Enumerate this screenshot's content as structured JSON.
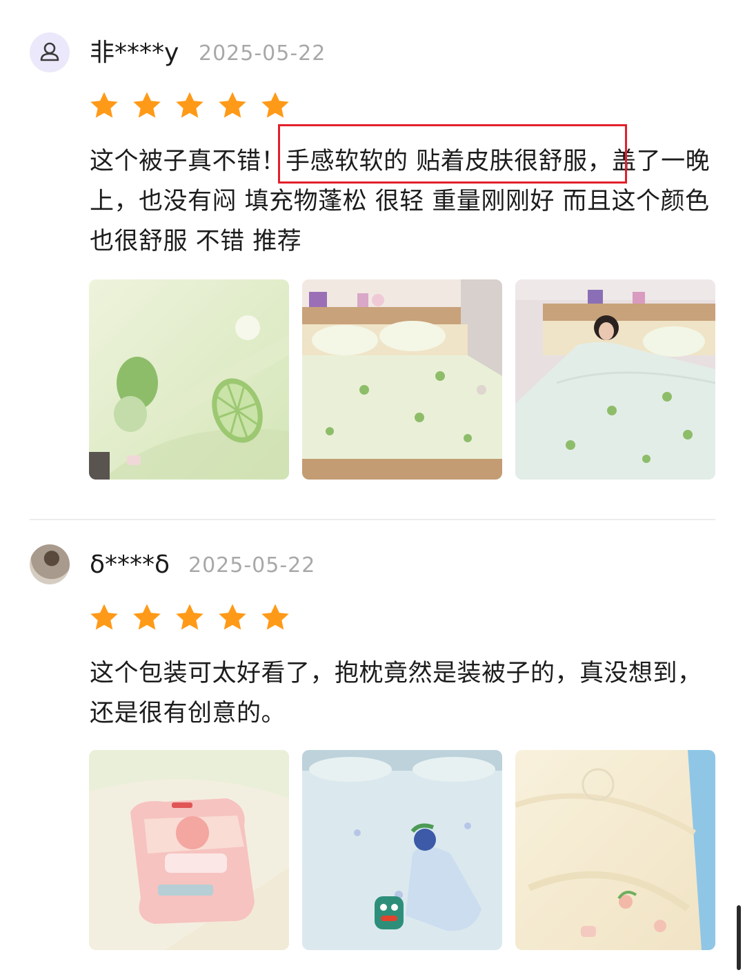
{
  "reviews": [
    {
      "username": "非****y",
      "date": "2025-05-22",
      "rating": 5,
      "text": "这个被子真不错！手感软软的 贴着皮肤很舒服，盖了一晚上，也没有闷 填充物蓬松 很轻 重量刚刚好 而且这个颜色也很舒服 不错 推荐",
      "avatar_icon": "person-icon",
      "photos": 3
    },
    {
      "username": "δ****δ",
      "date": "2025-05-22",
      "rating": 5,
      "text": "这个包装可太好看了，抱枕竟然是装被子的，真没想到，还是很有创意的。",
      "avatar_icon": "user-photo-avatar",
      "photos": 3
    }
  ],
  "colors": {
    "star": "#ff9a18",
    "highlight": "#e2202a",
    "date": "#a8a8a8",
    "avatar_bg": "#ece8fb"
  }
}
